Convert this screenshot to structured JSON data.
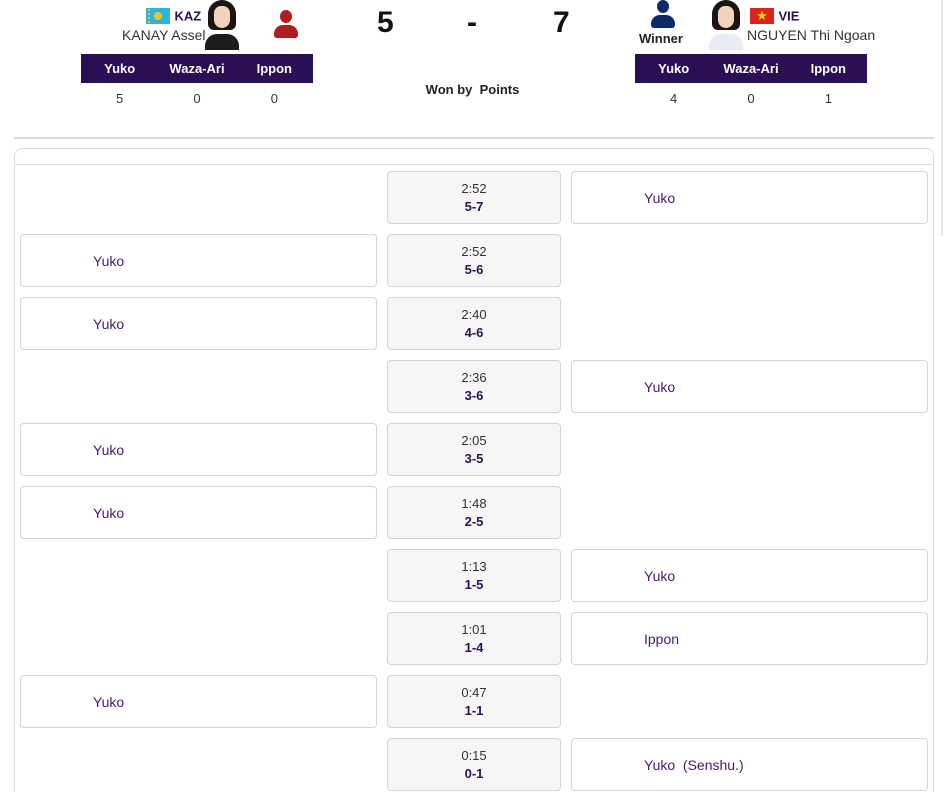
{
  "left_athlete": {
    "noc": "KAZ",
    "name": "KANAY Assel",
    "flag_icon": "kazakhstan-flag-icon",
    "score_headers": [
      "Yuko",
      "Waza-Ari",
      "Ippon"
    ],
    "score_values": [
      "5",
      "0",
      "0"
    ]
  },
  "right_athlete": {
    "noc": "VIE",
    "name": "NGUYEN Thi Ngoan",
    "flag_icon": "vietnam-flag-icon",
    "winner_label": "Winner",
    "score_headers": [
      "Yuko",
      "Waza-Ari",
      "Ippon"
    ],
    "score_values": [
      "4",
      "0",
      "1"
    ]
  },
  "match": {
    "left_score": "5",
    "separator": "-",
    "right_score": "7",
    "result": "Won by  Points"
  },
  "colors": {
    "header_bg": "#2b0f55",
    "event_text": "#4a1a6b",
    "red_athlete": "#b01d1d",
    "blue_athlete": "#0d2a6b"
  },
  "timeline": [
    {
      "time": "2:52",
      "score": "5-7",
      "side": "right",
      "event": "Yuko"
    },
    {
      "time": "2:52",
      "score": "5-6",
      "side": "left",
      "event": "Yuko"
    },
    {
      "time": "2:40",
      "score": "4-6",
      "side": "left",
      "event": "Yuko"
    },
    {
      "time": "2:36",
      "score": "3-6",
      "side": "right",
      "event": "Yuko"
    },
    {
      "time": "2:05",
      "score": "3-5",
      "side": "left",
      "event": "Yuko"
    },
    {
      "time": "1:48",
      "score": "2-5",
      "side": "left",
      "event": "Yuko"
    },
    {
      "time": "1:13",
      "score": "1-5",
      "side": "right",
      "event": "Yuko"
    },
    {
      "time": "1:01",
      "score": "1-4",
      "side": "right",
      "event": "Ippon"
    },
    {
      "time": "0:47",
      "score": "1-1",
      "side": "left",
      "event": "Yuko"
    },
    {
      "time": "0:15",
      "score": "0-1",
      "side": "right",
      "event": "Yuko  (Senshu.)"
    }
  ]
}
